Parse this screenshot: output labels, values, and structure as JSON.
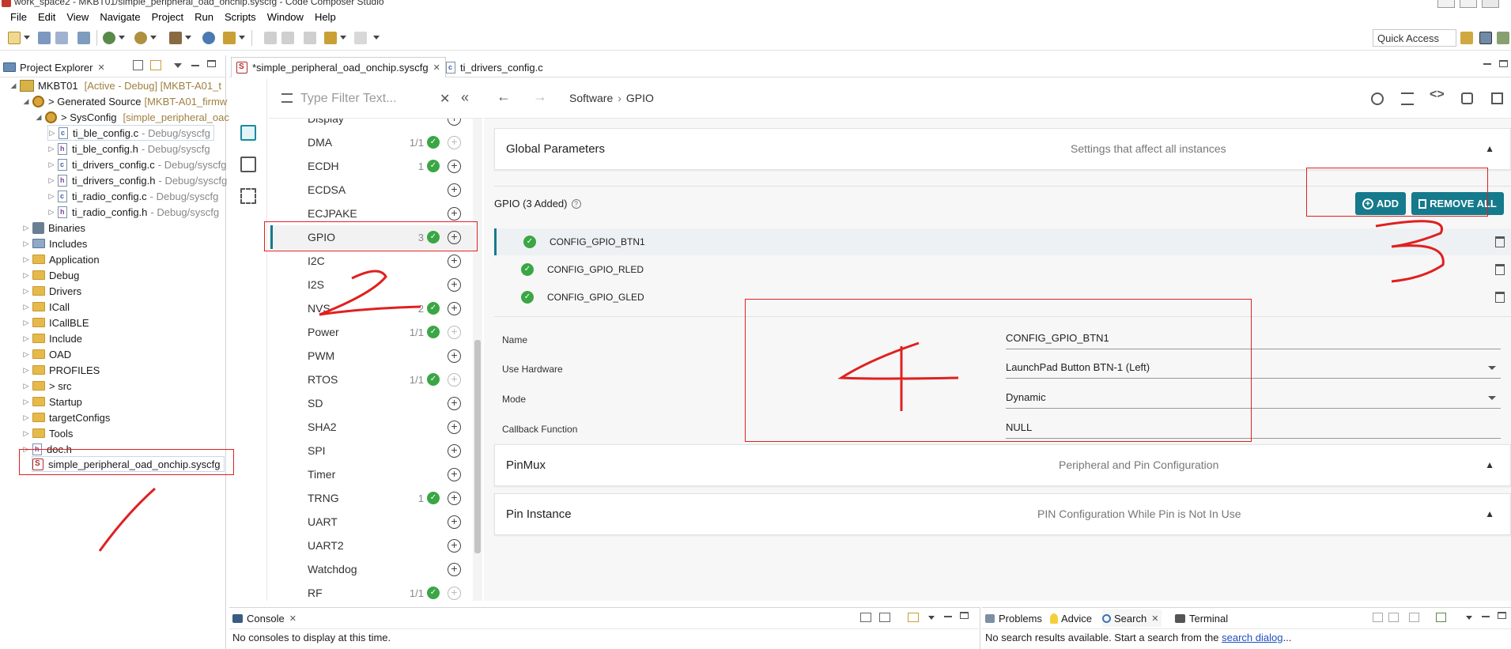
{
  "window": {
    "title": "work_space2 - MKBT01/simple_peripheral_oad_onchip.syscfg - Code Composer Studio"
  },
  "menu": [
    "File",
    "Edit",
    "View",
    "Navigate",
    "Project",
    "Run",
    "Scripts",
    "Window",
    "Help"
  ],
  "toolbar": {
    "quick_access": "Quick Access"
  },
  "project_explorer": {
    "tab_label": "Project Explorer",
    "project": {
      "name": "MKBT01",
      "decoration": "[Active - Debug] [MKBT-A01_t"
    },
    "generated_source": {
      "name": "> Generated Source",
      "decoration": "[MKBT-A01_firmw"
    },
    "sysconfig": {
      "name": "> SysConfig",
      "decoration": "[simple_peripheral_oac"
    },
    "generated_files": [
      {
        "name": "ti_ble_config.c",
        "path": "- Debug/syscfg",
        "type": "c"
      },
      {
        "name": "ti_ble_config.h",
        "path": "- Debug/syscfg",
        "type": "h"
      },
      {
        "name": "ti_drivers_config.c",
        "path": "- Debug/syscfg",
        "type": "c"
      },
      {
        "name": "ti_drivers_config.h",
        "path": "- Debug/syscfg",
        "type": "h"
      },
      {
        "name": "ti_radio_config.c",
        "path": "- Debug/syscfg",
        "type": "c"
      },
      {
        "name": "ti_radio_config.h",
        "path": "- Debug/syscfg",
        "type": "h"
      }
    ],
    "folders": [
      "Binaries",
      "Includes",
      "Application",
      "Debug",
      "Drivers",
      "ICall",
      "ICallBLE",
      "Include",
      "OAD",
      "PROFILES",
      "> src",
      "Startup",
      "targetConfigs",
      "Tools"
    ],
    "doc_file": "doc.h",
    "syscfg_file": "simple_peripheral_oad_onchip.syscfg"
  },
  "editor_tabs": [
    {
      "label": "*simple_peripheral_oad_onchip.syscfg",
      "active": true
    },
    {
      "label": "ti_drivers_config.c",
      "active": false
    }
  ],
  "module_filter": {
    "placeholder": "Type Filter Text..."
  },
  "modules": [
    {
      "name": "Display",
      "count": "",
      "checked": false,
      "disabled": false
    },
    {
      "name": "DMA",
      "count": "1/1",
      "checked": true,
      "disabled": true
    },
    {
      "name": "ECDH",
      "count": "1",
      "checked": true,
      "disabled": false
    },
    {
      "name": "ECDSA",
      "count": "",
      "checked": false,
      "disabled": false
    },
    {
      "name": "ECJPAKE",
      "count": "",
      "checked": false,
      "disabled": false
    },
    {
      "name": "GPIO",
      "count": "3",
      "checked": true,
      "disabled": false
    },
    {
      "name": "I2C",
      "count": "",
      "checked": false,
      "disabled": false
    },
    {
      "name": "I2S",
      "count": "",
      "checked": false,
      "disabled": false
    },
    {
      "name": "NVS",
      "count": "2",
      "checked": true,
      "disabled": false
    },
    {
      "name": "Power",
      "count": "1/1",
      "checked": true,
      "disabled": true
    },
    {
      "name": "PWM",
      "count": "",
      "checked": false,
      "disabled": false
    },
    {
      "name": "RTOS",
      "count": "1/1",
      "checked": true,
      "disabled": true
    },
    {
      "name": "SD",
      "count": "",
      "checked": false,
      "disabled": false
    },
    {
      "name": "SHA2",
      "count": "",
      "checked": false,
      "disabled": false
    },
    {
      "name": "SPI",
      "count": "",
      "checked": false,
      "disabled": false
    },
    {
      "name": "Timer",
      "count": "",
      "checked": false,
      "disabled": false
    },
    {
      "name": "TRNG",
      "count": "1",
      "checked": true,
      "disabled": false
    },
    {
      "name": "UART",
      "count": "",
      "checked": false,
      "disabled": false
    },
    {
      "name": "UART2",
      "count": "",
      "checked": false,
      "disabled": false
    },
    {
      "name": "Watchdog",
      "count": "",
      "checked": false,
      "disabled": false
    },
    {
      "name": "RF",
      "count": "1/1",
      "checked": true,
      "disabled": true
    }
  ],
  "breadcrumb": {
    "root": "Software",
    "separator": "›",
    "current": "GPIO"
  },
  "global_parameters": {
    "title": "Global Parameters",
    "desc": "Settings that affect all instances"
  },
  "gpio": {
    "header": "GPIO (3 Added)",
    "add_label": "ADD",
    "remove_all_label": "REMOVE ALL",
    "instances": [
      "CONFIG_GPIO_BTN1",
      "CONFIG_GPIO_RLED",
      "CONFIG_GPIO_GLED"
    ]
  },
  "properties": [
    {
      "label": "Name",
      "value": "CONFIG_GPIO_BTN1",
      "dropdown": false
    },
    {
      "label": "Use Hardware",
      "value": "LaunchPad Button BTN-1 (Left)",
      "dropdown": true
    },
    {
      "label": "Mode",
      "value": "Dynamic",
      "dropdown": true
    },
    {
      "label": "Callback Function",
      "value": "NULL",
      "dropdown": false
    }
  ],
  "pinmux": {
    "title": "PinMux",
    "desc": "Peripheral and Pin Configuration"
  },
  "pin_instance": {
    "title": "Pin Instance",
    "desc": "PIN Configuration While Pin is Not In Use"
  },
  "console": {
    "tab_label": "Console",
    "message": "No consoles to display at this time."
  },
  "bottom_right": {
    "tabs": [
      "Problems",
      "Advice",
      "Search",
      "Terminal"
    ],
    "message_prefix": "No search results available. Start a search from the ",
    "link": "search dialog",
    "message_suffix": "..."
  },
  "annotations": [
    "1",
    "2",
    "3",
    "4"
  ],
  "colors": {
    "accent": "#157a8c",
    "check": "#3aa644",
    "annotation": "#e02020"
  }
}
